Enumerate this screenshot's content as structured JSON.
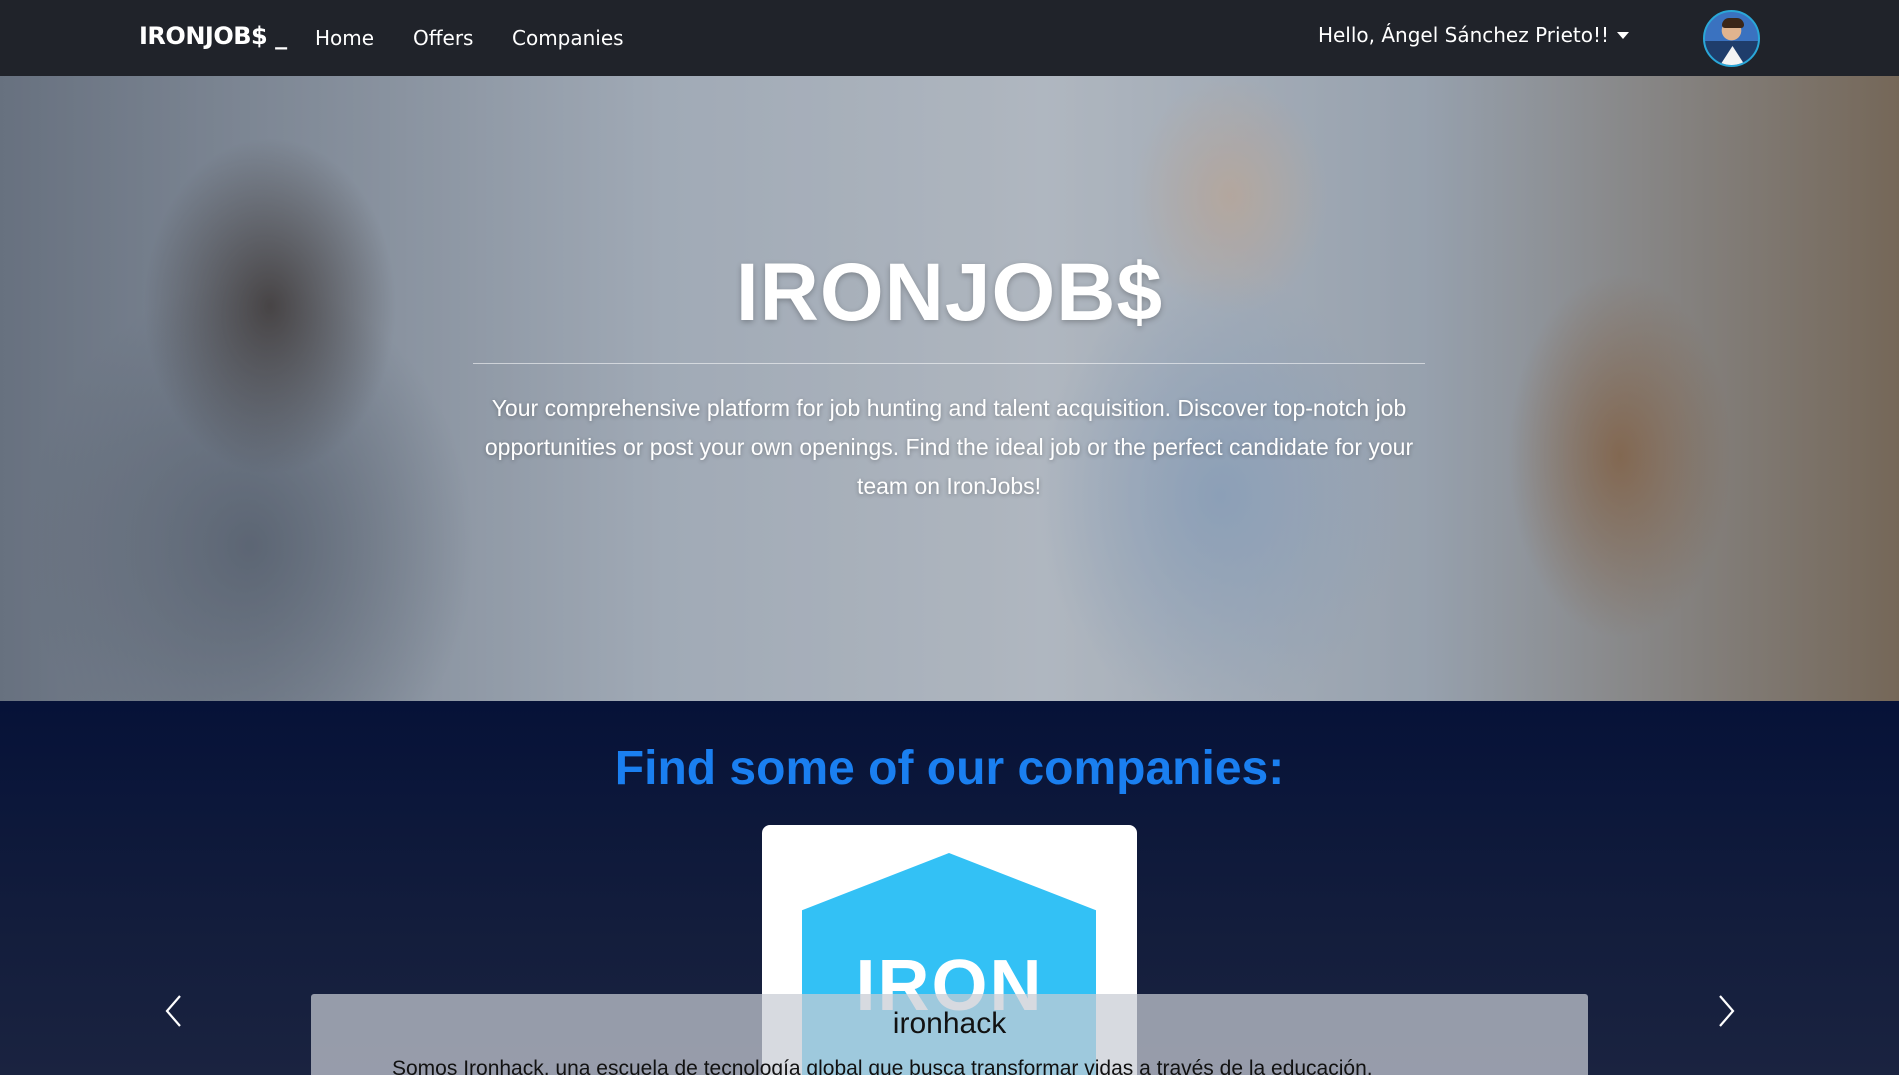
{
  "navbar": {
    "brand": "IRONJOB$ _",
    "links": [
      "Home",
      "Offers",
      "Companies"
    ],
    "greeting": "Hello, Ángel Sánchez Prieto!!"
  },
  "hero": {
    "title": "IRONJOB$",
    "text": "Your comprehensive platform for job hunting and talent acquisition. Discover top-notch job opportunities or post your own openings. Find the ideal job or the perfect candidate for your team on IronJobs!"
  },
  "companies": {
    "title": "Find some of our companies:",
    "logo_text": "IRON",
    "caption_title": "ironhack",
    "caption_text": "Somos Ironhack, una escuela de tecnología global que busca transformar vidas a través de la educación."
  },
  "colors": {
    "navbar_bg": "#20232a",
    "section_title": "#1a7ff0",
    "logo_blue": "#33c1f5"
  }
}
